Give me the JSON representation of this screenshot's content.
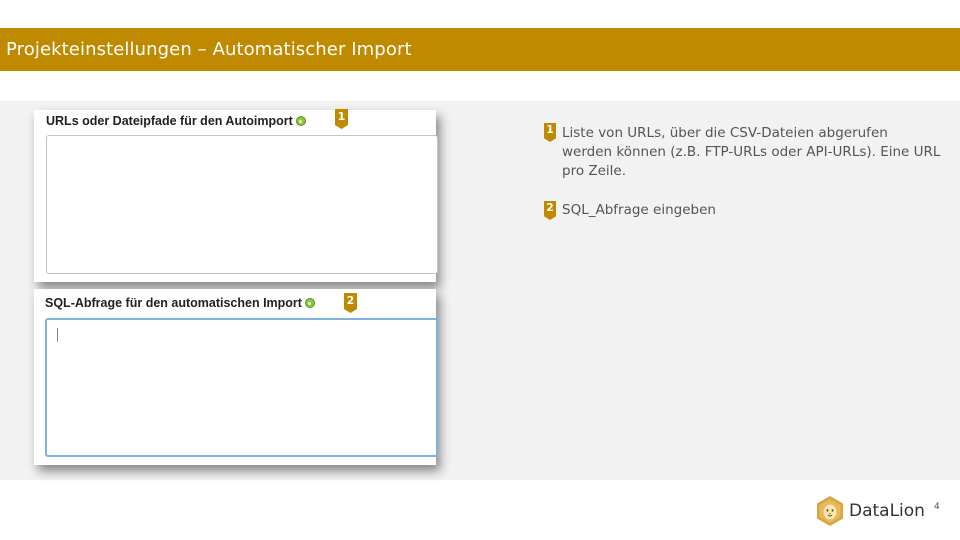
{
  "title": "Projekteinstellungen – Automatischer Import",
  "fields": [
    {
      "label": "URLs oder Dateipfade für den Autoimport",
      "marker": "1",
      "value": ""
    },
    {
      "label": "SQL-Abfrage für den automatischen Import",
      "marker": "2",
      "value": ""
    }
  ],
  "notes": [
    {
      "marker": "1",
      "text": "Liste von URLs, über die CSV-Dateien abgerufen werden können (z.B. FTP-URLs oder API-URLs). Eine URL pro Zeile."
    },
    {
      "marker": "2",
      "text": "SQL_Abfrage eingeben"
    }
  ],
  "footer": {
    "brand": "DataLion",
    "page_number": "4"
  },
  "colors": {
    "accent": "#bf8a00",
    "panel": "#f2f2f2",
    "help_icon": "#8cc63f",
    "focus_border": "#7fb2df"
  },
  "icons": {
    "help": "help-icon",
    "logo": "lion-logo-icon"
  }
}
